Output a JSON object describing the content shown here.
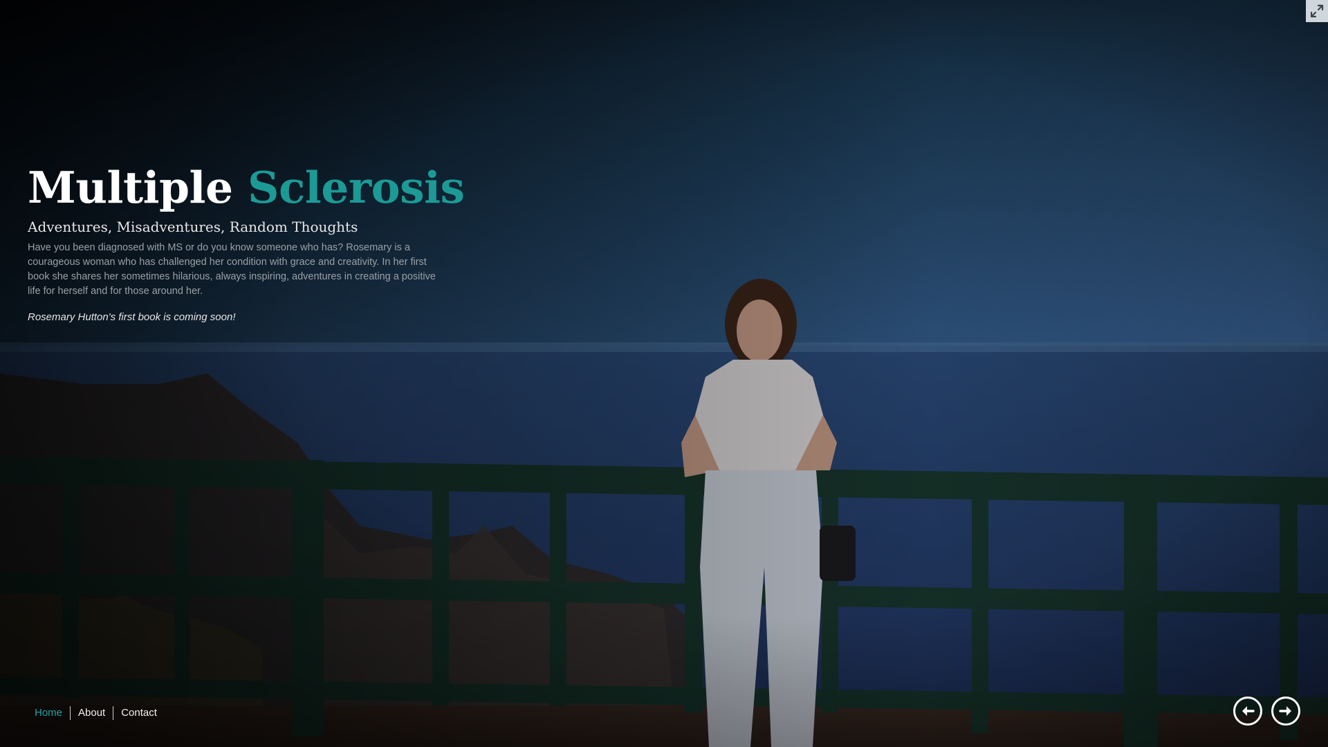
{
  "hero": {
    "title_word1": "Multiple",
    "title_word2": "Sclerosis",
    "subtitle": "Adventures, Misadventures, Random Thoughts",
    "description": "Have you been diagnosed with MS or do you know someone who has? Rosemary is a courageous woman who has challenged her condition with grace and creativity. In her first book she shares her sometimes hilarious, always inspiring, adventures in creating a positive life for herself and for those around her.",
    "coming_soon": "Rosemary Hutton's first book is coming soon!"
  },
  "nav": {
    "items": [
      {
        "label": "Home",
        "active": true
      },
      {
        "label": "About",
        "active": false
      },
      {
        "label": "Contact",
        "active": false
      }
    ]
  },
  "controls": {
    "prev_icon": "arrow-left-circle-icon",
    "next_icon": "arrow-right-circle-icon",
    "fullscreen_icon": "exit-fullscreen-icon"
  },
  "colors": {
    "accent": "#1c9a96",
    "nav_active": "#1fa3a8",
    "text_primary": "#ffffff",
    "text_muted": "#9aa0a6"
  }
}
